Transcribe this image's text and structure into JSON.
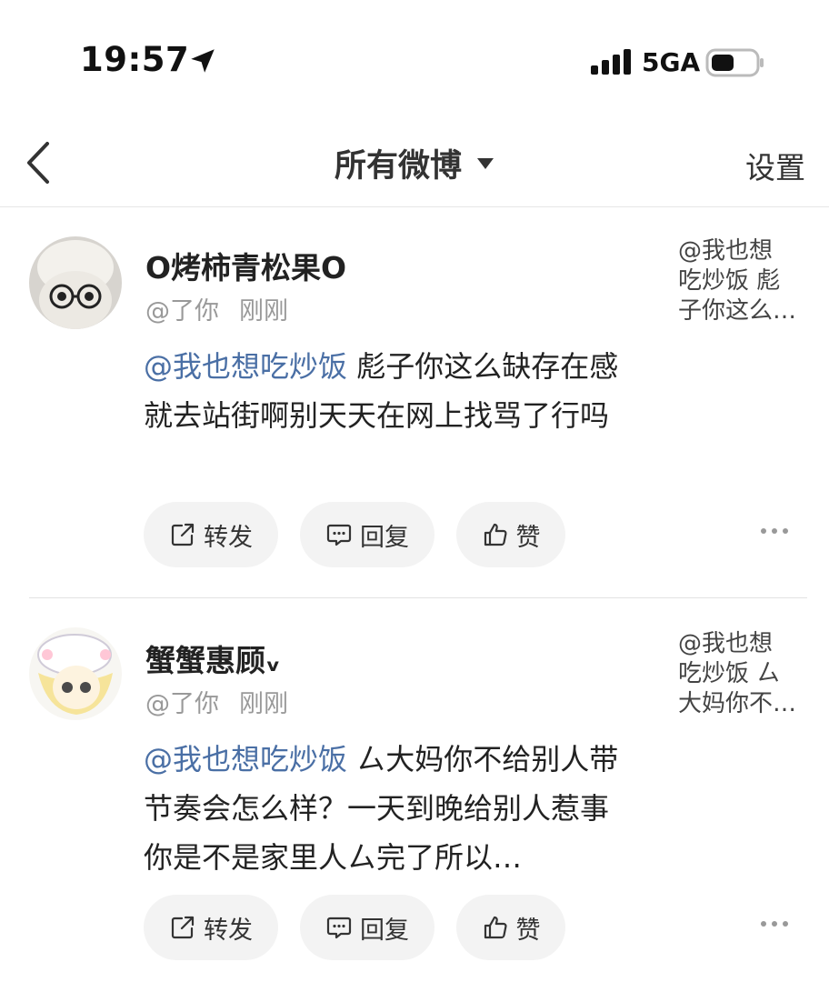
{
  "status_bar": {
    "time": "19:57",
    "network": "5GA",
    "icons": [
      "location-arrow-icon",
      "signal-icon",
      "battery-icon"
    ]
  },
  "nav": {
    "back_icon": "chevron-left-icon",
    "title": "所有微博",
    "dropdown_icon": "caret-down-icon",
    "settings_label": "设置"
  },
  "messages": [
    {
      "user_name": "O烤柿青松果O",
      "at_label": "@了你",
      "time_label": "刚刚",
      "mention": "@我也想吃炒饭",
      "text": " 彪子你这么缺存在感就去站街啊别天天在网上找骂了行吗",
      "quote_lines": [
        "@我也想",
        "吃炒饭 彪",
        "子你这么…"
      ],
      "actions": {
        "forward": "转发",
        "reply": "回复",
        "like": "赞"
      }
    },
    {
      "user_name": "蟹蟹惠顾ᵥ",
      "at_label": "@了你",
      "time_label": "刚刚",
      "mention": "@我也想吃炒饭",
      "text": " ㄙ大妈你不给别人带节奏会怎么样？一天到晚给别人惹事你是不是家里人ㄙ完了所以…",
      "quote_lines": [
        "@我也想",
        "吃炒饭 ㄙ",
        "大妈你不…"
      ],
      "actions": {
        "forward": "转发",
        "reply": "回复",
        "like": "赞"
      }
    }
  ],
  "colors": {
    "mention": "#4a6fa5",
    "meta": "#999999",
    "button_bg": "#f3f3f3"
  }
}
